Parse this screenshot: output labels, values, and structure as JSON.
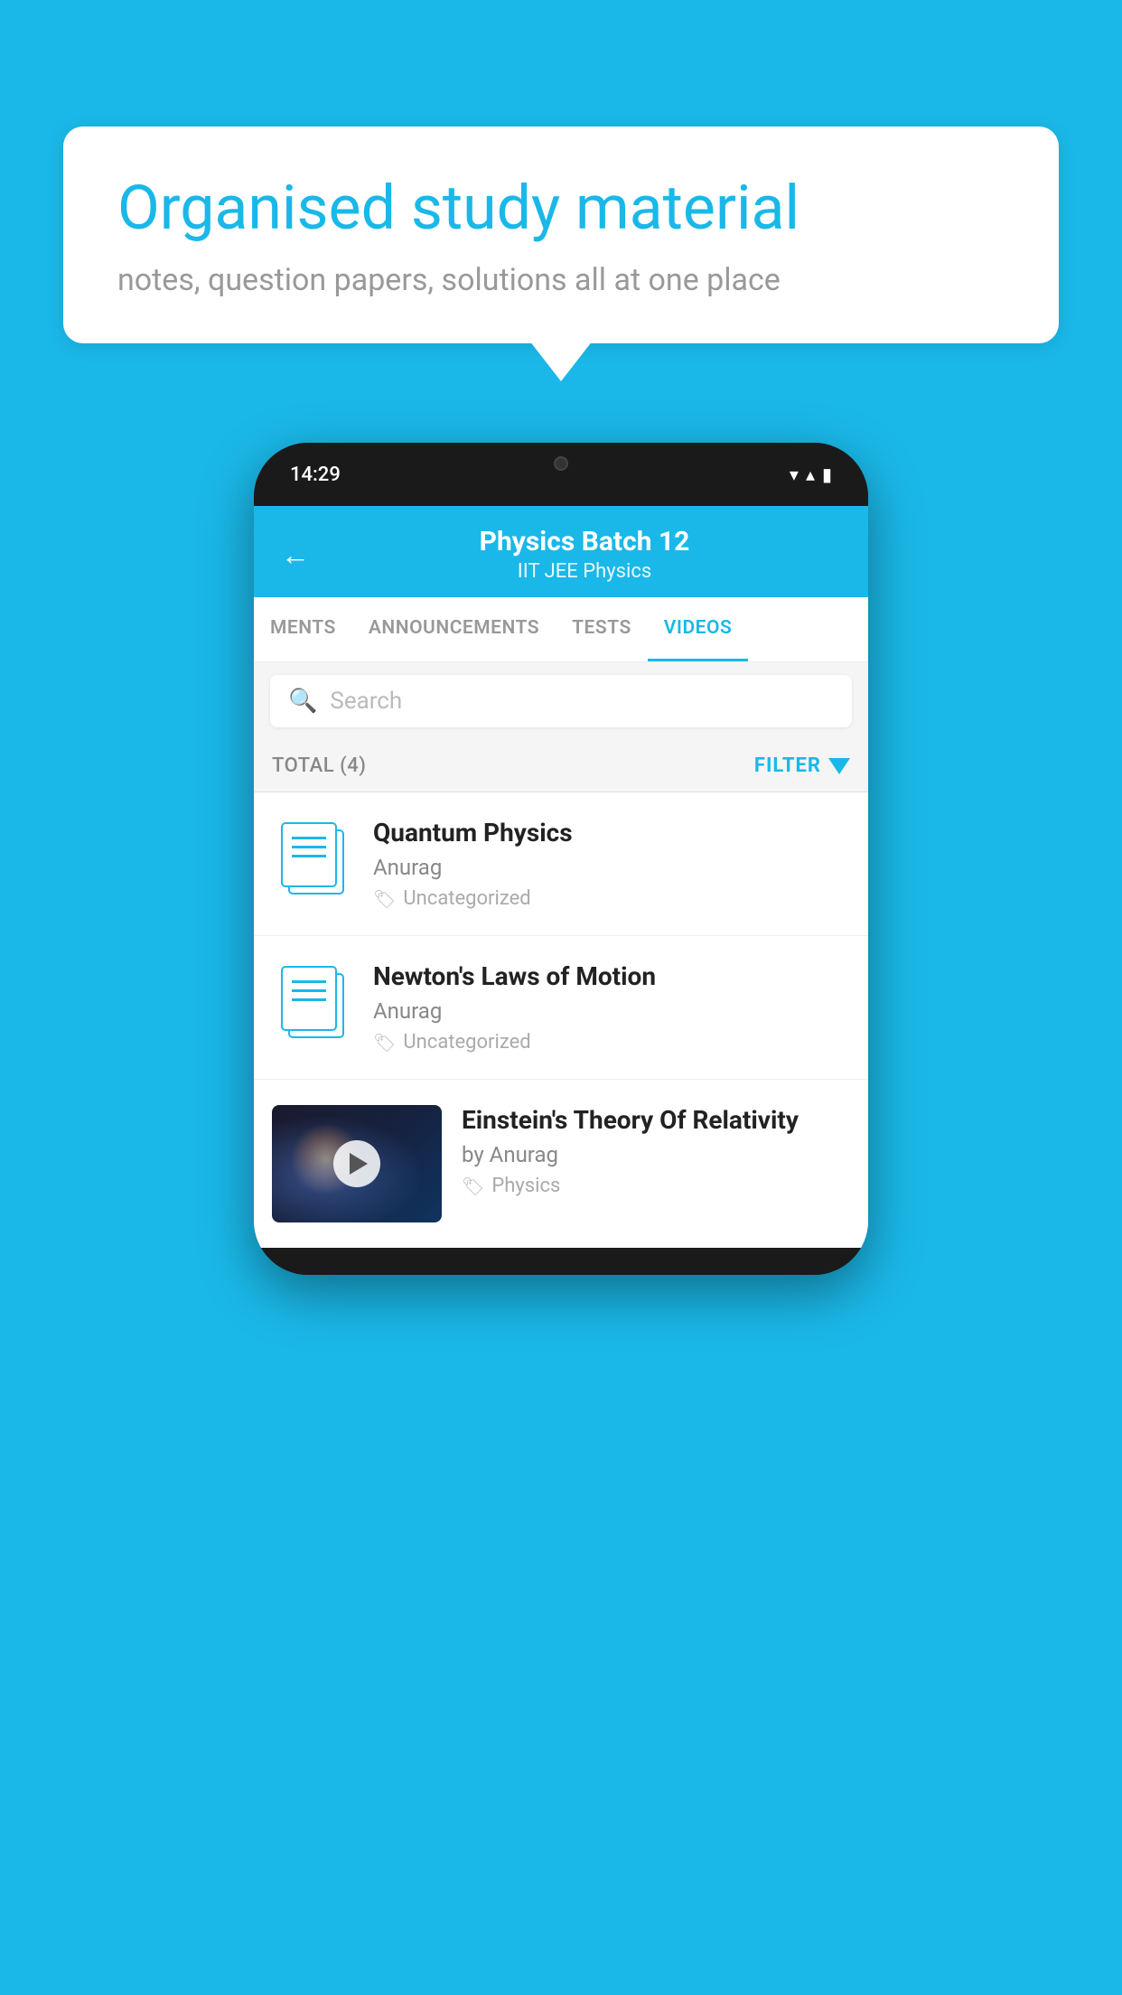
{
  "background": {
    "color": "#1ab8e8"
  },
  "speechBubble": {
    "title": "Organised study material",
    "subtitle": "notes, question papers, solutions all at one place"
  },
  "phone": {
    "statusBar": {
      "time": "14:29",
      "icons": [
        "wifi",
        "signal",
        "battery"
      ]
    },
    "header": {
      "backLabel": "←",
      "batchName": "Physics Batch 12",
      "tags": "IIT JEE   Physics"
    },
    "tabs": [
      {
        "label": "MENTS",
        "active": false
      },
      {
        "label": "ANNOUNCEMENTS",
        "active": false
      },
      {
        "label": "TESTS",
        "active": false
      },
      {
        "label": "VIDEOS",
        "active": true
      }
    ],
    "search": {
      "placeholder": "Search"
    },
    "filterBar": {
      "totalLabel": "TOTAL (4)",
      "filterLabel": "FILTER"
    },
    "videoItems": [
      {
        "title": "Quantum Physics",
        "author": "Anurag",
        "tag": "Uncategorized",
        "type": "doc"
      },
      {
        "title": "Newton's Laws of Motion",
        "author": "Anurag",
        "tag": "Uncategorized",
        "type": "doc"
      },
      {
        "title": "Einstein's Theory Of Relativity",
        "author": "by Anurag",
        "tag": "Physics",
        "type": "video"
      }
    ]
  }
}
